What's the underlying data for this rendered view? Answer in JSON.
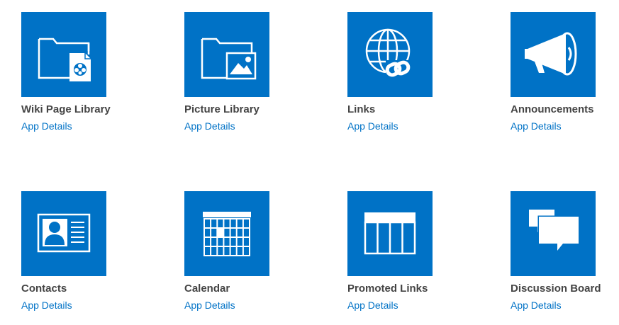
{
  "apps": [
    {
      "title": "Wiki Page Library",
      "link": "App Details",
      "icon": "wiki-page-library-icon"
    },
    {
      "title": "Picture Library",
      "link": "App Details",
      "icon": "picture-library-icon"
    },
    {
      "title": "Links",
      "link": "App Details",
      "icon": "links-icon"
    },
    {
      "title": "Announcements",
      "link": "App Details",
      "icon": "announcements-icon"
    },
    {
      "title": "Contacts",
      "link": "App Details",
      "icon": "contacts-icon"
    },
    {
      "title": "Calendar",
      "link": "App Details",
      "icon": "calendar-icon"
    },
    {
      "title": "Promoted Links",
      "link": "App Details",
      "icon": "promoted-links-icon"
    },
    {
      "title": "Discussion Board",
      "link": "App Details",
      "icon": "discussion-board-icon"
    }
  ],
  "colors": {
    "tile_background": "#0072c6",
    "title_text": "#444444",
    "link_text": "#0072c6"
  }
}
